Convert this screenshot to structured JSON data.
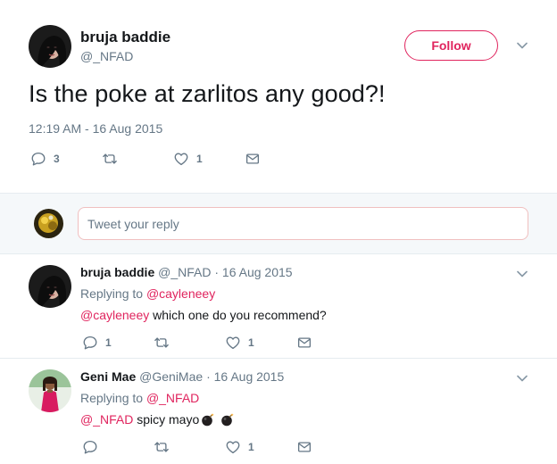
{
  "main_tweet": {
    "name": "bruja baddie",
    "handle": "@_NFAD",
    "follow_label": "Follow",
    "text": "Is the poke at zarlitos any good?!",
    "timestamp": "12:19 AM - 16 Aug 2015",
    "reply_count": "3",
    "retweet_count": "",
    "like_count": "1"
  },
  "reply_box": {
    "placeholder": "Tweet your reply"
  },
  "replies": [
    {
      "name": "bruja baddie",
      "handle": "@_NFAD",
      "separator": "·",
      "date": "16 Aug 2015",
      "replying_prefix": "Replying to",
      "replying_to": "@cayleneey",
      "mention": "@cayleneey",
      "text": "which one do you recommend?",
      "reply_count": "1",
      "retweet_count": "",
      "like_count": "1"
    },
    {
      "name": "Geni Mae",
      "handle": "@GeniMae",
      "separator": "·",
      "date": "16 Aug 2015",
      "replying_prefix": "Replying to",
      "replying_to": "@_NFAD",
      "mention": "@_NFAD",
      "text": "spicy mayo",
      "emoji": [
        "bomb-icon",
        "bomb-icon"
      ],
      "reply_count": "",
      "retweet_count": "",
      "like_count": "1"
    }
  ],
  "colors": {
    "accent": "#e0245e",
    "secondary_text": "#657786",
    "primary_text": "#14171a",
    "band": "#f5f8fa"
  }
}
